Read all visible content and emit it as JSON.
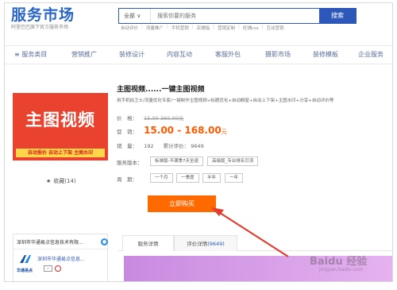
{
  "header": {
    "logo_text": "服务市场",
    "logo_sub": "阿里巴巴旗下官方服务市场",
    "search": {
      "scope": "全部 ∨",
      "placeholder": "搜索你要的服务",
      "button": "搜索"
    },
    "hotwords": [
      "自动评价",
      "流量推广",
      "手机营销",
      "店铺指",
      "营销定制",
      "旺铺css",
      "互动营销"
    ]
  },
  "nav": {
    "items": [
      "≡ 服务类目",
      "营销推广",
      "装修设计",
      "内容互动",
      "客服外包",
      "摄影市场",
      "装修模板",
      "企业服务"
    ]
  },
  "product": {
    "image_title": "主图视频",
    "image_bar": "自动报价  自动上下架  主图水印",
    "title": "主图视频......一键主图视频",
    "desc": "用手机拍卫士/流量优化专家/一键制作主图视频+标题优化+自动橱窗+自动上下架+主图水印+分享+自动评价等",
    "price_label": "价　格：",
    "price_orig": "15.00-360.00元",
    "sale_label": "促　销：",
    "sale_price": "15.00 - 168.00",
    "sale_unit": "元",
    "sales_label": "销　量：",
    "sales_value": "192",
    "rating_label": "累计评价：",
    "rating_value": "9649",
    "version_label": "服务版本：",
    "versions": [
      "标准版-不满季7天全退",
      "高级版_专业排名引流"
    ],
    "period_label": "周　期：",
    "periods": [
      "一个月",
      "一季度",
      "半年",
      "一年"
    ],
    "buy_button": "立即购买",
    "favorite": "收藏(14)"
  },
  "store": {
    "name": "深圳市华通易点信息技术有限...",
    "link": "深圳市华通易点信息...",
    "logo_text": "华通易点"
  },
  "tabs": {
    "detail": "服务详情",
    "reviews_label": "评价详情",
    "reviews_count": "(9649)"
  },
  "watermark": {
    "main": "Baidu 经验",
    "sub": "jingyan.baidu.com"
  },
  "colors": {
    "brand_blue": "#2d57b8",
    "buy_orange": "#ff6a00",
    "price_orange": "#ff5a00",
    "product_red": "#e9422f",
    "arrow_red": "#e33b2e"
  }
}
